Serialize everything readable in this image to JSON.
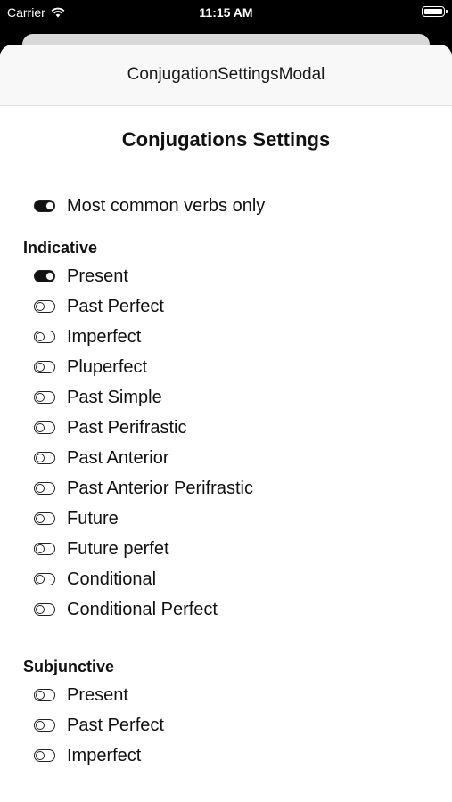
{
  "status_bar": {
    "carrier": "Carrier",
    "time": "11:15 AM"
  },
  "nav": {
    "title": "ConjugationSettingsModal"
  },
  "settings": {
    "title": "Conjugations Settings",
    "common_verbs": {
      "label": "Most common verbs only",
      "on": true
    }
  },
  "indicative": {
    "title": "Indicative",
    "items": [
      {
        "label": "Present",
        "on": true
      },
      {
        "label": "Past Perfect",
        "on": false
      },
      {
        "label": "Imperfect",
        "on": false
      },
      {
        "label": "Pluperfect",
        "on": false
      },
      {
        "label": "Past Simple",
        "on": false
      },
      {
        "label": "Past Perifrastic",
        "on": false
      },
      {
        "label": "Past Anterior",
        "on": false
      },
      {
        "label": "Past Anterior Perifrastic",
        "on": false
      },
      {
        "label": "Future",
        "on": false
      },
      {
        "label": "Future perfet",
        "on": false
      },
      {
        "label": "Conditional",
        "on": false
      },
      {
        "label": "Conditional Perfect",
        "on": false
      }
    ]
  },
  "subjunctive": {
    "title": "Subjunctive",
    "items": [
      {
        "label": "Present",
        "on": false
      },
      {
        "label": "Past Perfect",
        "on": false
      },
      {
        "label": "Imperfect",
        "on": false
      }
    ]
  }
}
